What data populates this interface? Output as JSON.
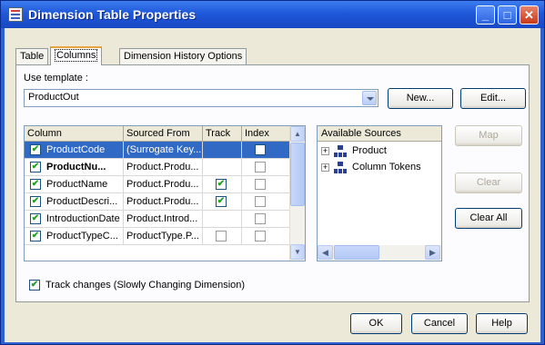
{
  "window": {
    "title": "Dimension Table Properties",
    "controls": {
      "minimize": "_",
      "maximize": "□",
      "close": "✕"
    }
  },
  "tabs": [
    {
      "label": "Table",
      "active": false
    },
    {
      "label": "Columns",
      "active": true
    },
    {
      "label": "Dimension History Options",
      "active": false
    }
  ],
  "template": {
    "label": "Use template :",
    "value": "ProductOut",
    "new_label": "New...",
    "edit_label": "Edit..."
  },
  "columns_grid": {
    "headers": {
      "column": "Column",
      "sourced_from": "Sourced From",
      "track": "Track",
      "index": "Index"
    },
    "rows": [
      {
        "name": "ProductCode",
        "source": "(Surrogate Key...",
        "enabled": true,
        "track": null,
        "index": false,
        "selected": true,
        "bold": false
      },
      {
        "name": "ProductNu...",
        "source": "Product.Produ...",
        "enabled": true,
        "track": null,
        "index": false,
        "selected": false,
        "bold": true
      },
      {
        "name": "ProductName",
        "source": "Product.Produ...",
        "enabled": true,
        "track": true,
        "index": false,
        "selected": false,
        "bold": false
      },
      {
        "name": "ProductDescri...",
        "source": "Product.Produ...",
        "enabled": true,
        "track": true,
        "index": false,
        "selected": false,
        "bold": false
      },
      {
        "name": "IntroductionDate",
        "source": "Product.Introd...",
        "enabled": true,
        "track": null,
        "index": false,
        "selected": false,
        "bold": false
      },
      {
        "name": "ProductTypeC...",
        "source": "ProductType.P...",
        "enabled": true,
        "track": false,
        "index": false,
        "selected": false,
        "bold": false
      }
    ]
  },
  "sources": {
    "header": "Available Sources",
    "nodes": [
      {
        "label": "Product"
      },
      {
        "label": "Column Tokens"
      }
    ]
  },
  "side_buttons": {
    "map": "Map",
    "clear": "Clear",
    "clear_all": "Clear All"
  },
  "track_changes": {
    "checked": true,
    "label": "Track changes (Slowly Changing Dimension)"
  },
  "footer": {
    "ok": "OK",
    "cancel": "Cancel",
    "help": "Help"
  },
  "colors": {
    "selection": "#316ac5",
    "titlebar": "#1f58d8",
    "dialog_bg": "#ece9d8"
  }
}
